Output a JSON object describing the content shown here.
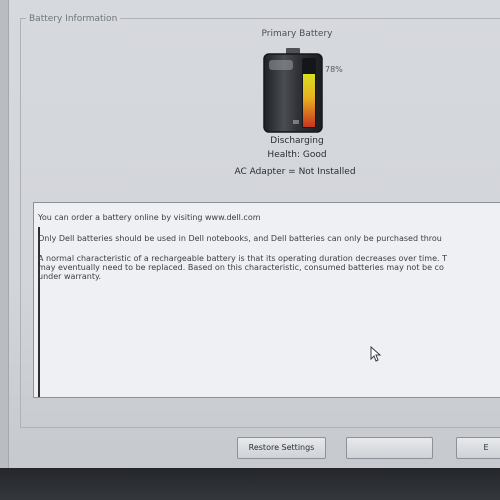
{
  "window": {
    "section_title": "Battery Information"
  },
  "battery": {
    "label": "Primary Battery",
    "percent_text": "78%",
    "charge_level": 0.78,
    "status": "Discharging",
    "health": "Health: Good",
    "ac_adapter": "AC Adapter = Not Installed"
  },
  "info": {
    "line1": "You can order a battery online by visiting www.dell.com",
    "line2": "Only Dell batteries should be used in Dell notebooks, and Dell batteries can only be purchased throu",
    "line3": "A normal characteristic of a rechargeable battery is that its operating duration decreases over time.  T",
    "line4": "may eventually need to be replaced.  Based on this characteristic, consumed batteries may not be co",
    "line5": "under warranty."
  },
  "buttons": {
    "restore_label": "Restore Settings",
    "next_label": "",
    "far_label": "E"
  },
  "colors": {
    "battery_gradient_top": "#d8e020",
    "battery_gradient_mid": "#f0a020",
    "battery_gradient_bottom": "#d03020",
    "battery_body": "#2b2d30"
  }
}
